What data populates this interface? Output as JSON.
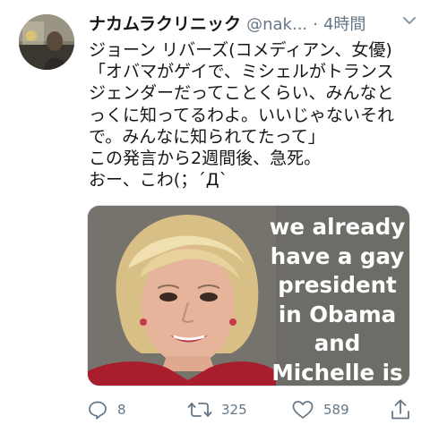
{
  "tweet": {
    "display_name": "ナカムラクリニック",
    "handle": "@nak...",
    "separator": "·",
    "time": "4時間",
    "body": "ジョーン リバーズ(コメディアン、女優)\n「オバマがゲイで、ミシェルがトランス\nジェンダーだってことくらい、みんなと\nっくに知ってるわよ。いいじゃないそれ\nで。みんなに知られてたって」\nこの発言から2週間後、急死。\nおー、こわ(；´Д`",
    "media": {
      "caption": "we already\nhave a gay\npresident\nin Obama\nand\nMichelle is"
    },
    "actions": {
      "reply_count": "8",
      "retweet_count": "325",
      "like_count": "589"
    },
    "icons": {
      "caret": "chevron-down-icon",
      "reply": "reply-icon",
      "retweet": "retweet-icon",
      "like": "heart-icon",
      "share": "share-icon"
    },
    "colors": {
      "text": "#14171a",
      "secondary": "#657786",
      "background": "#ffffff"
    }
  }
}
